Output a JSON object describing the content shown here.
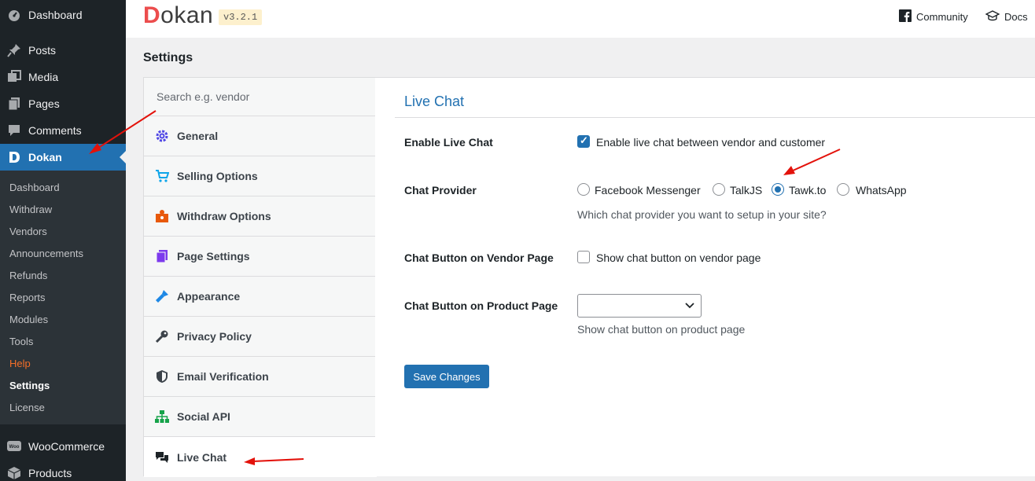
{
  "sidebar": {
    "items": [
      {
        "label": "Dashboard",
        "icon": "dashboard-icon"
      },
      {
        "label": "Posts",
        "icon": "pin-icon"
      },
      {
        "label": "Media",
        "icon": "media-icon"
      },
      {
        "label": "Pages",
        "icon": "pages-icon"
      },
      {
        "label": "Comments",
        "icon": "comment-icon"
      },
      {
        "label": "Dokan",
        "icon": "dokan-icon"
      },
      {
        "label": "WooCommerce",
        "icon": "woocommerce-icon"
      },
      {
        "label": "Products",
        "icon": "products-icon"
      }
    ],
    "submenu": [
      "Dashboard",
      "Withdraw",
      "Vendors",
      "Announcements",
      "Refunds",
      "Reports",
      "Modules",
      "Tools",
      "Help",
      "Settings",
      "License"
    ]
  },
  "header": {
    "logo_initial": "D",
    "logo_rest": "okan",
    "version": "v3.2.1",
    "community": "Community",
    "docs": "Docs"
  },
  "page_title": "Settings",
  "tabs": {
    "search_placeholder": "Search e.g. vendor",
    "items": [
      {
        "label": "General",
        "icon": "gear-icon",
        "color": "#4f46e5"
      },
      {
        "label": "Selling Options",
        "icon": "cart-icon",
        "color": "#0ea5e9"
      },
      {
        "label": "Withdraw Options",
        "icon": "withdraw-icon",
        "color": "#e8590c"
      },
      {
        "label": "Page Settings",
        "icon": "pages-icon",
        "color": "#7c3aed"
      },
      {
        "label": "Appearance",
        "icon": "brush-icon",
        "color": "#1e88e5"
      },
      {
        "label": "Privacy Policy",
        "icon": "key-icon",
        "color": "#3c434a"
      },
      {
        "label": "Email Verification",
        "icon": "shield-icon",
        "color": "#3c434a"
      },
      {
        "label": "Social API",
        "icon": "network-icon",
        "color": "#16a34a"
      },
      {
        "label": "Live Chat",
        "icon": "chat-icon",
        "color": "#1d2327"
      }
    ]
  },
  "live_chat": {
    "title": "Live Chat",
    "enable_label": "Enable Live Chat",
    "enable_text": "Enable live chat between vendor and customer",
    "enable_checked": true,
    "provider_label": "Chat Provider",
    "providers": [
      "Facebook Messenger",
      "TalkJS",
      "Tawk.to",
      "WhatsApp"
    ],
    "selected_provider": "Tawk.to",
    "provider_desc": "Which chat provider you want to setup in your site?",
    "vendor_label": "Chat Button on Vendor Page",
    "vendor_text": "Show chat button on vendor page",
    "vendor_checked": false,
    "product_label": "Chat Button on Product Page",
    "product_value": "",
    "product_desc": "Show chat button on product page",
    "save": "Save Changes"
  },
  "colors": {
    "accent": "#2271b1",
    "annotation": "#e3120b",
    "sidebar": "#1d2327"
  }
}
